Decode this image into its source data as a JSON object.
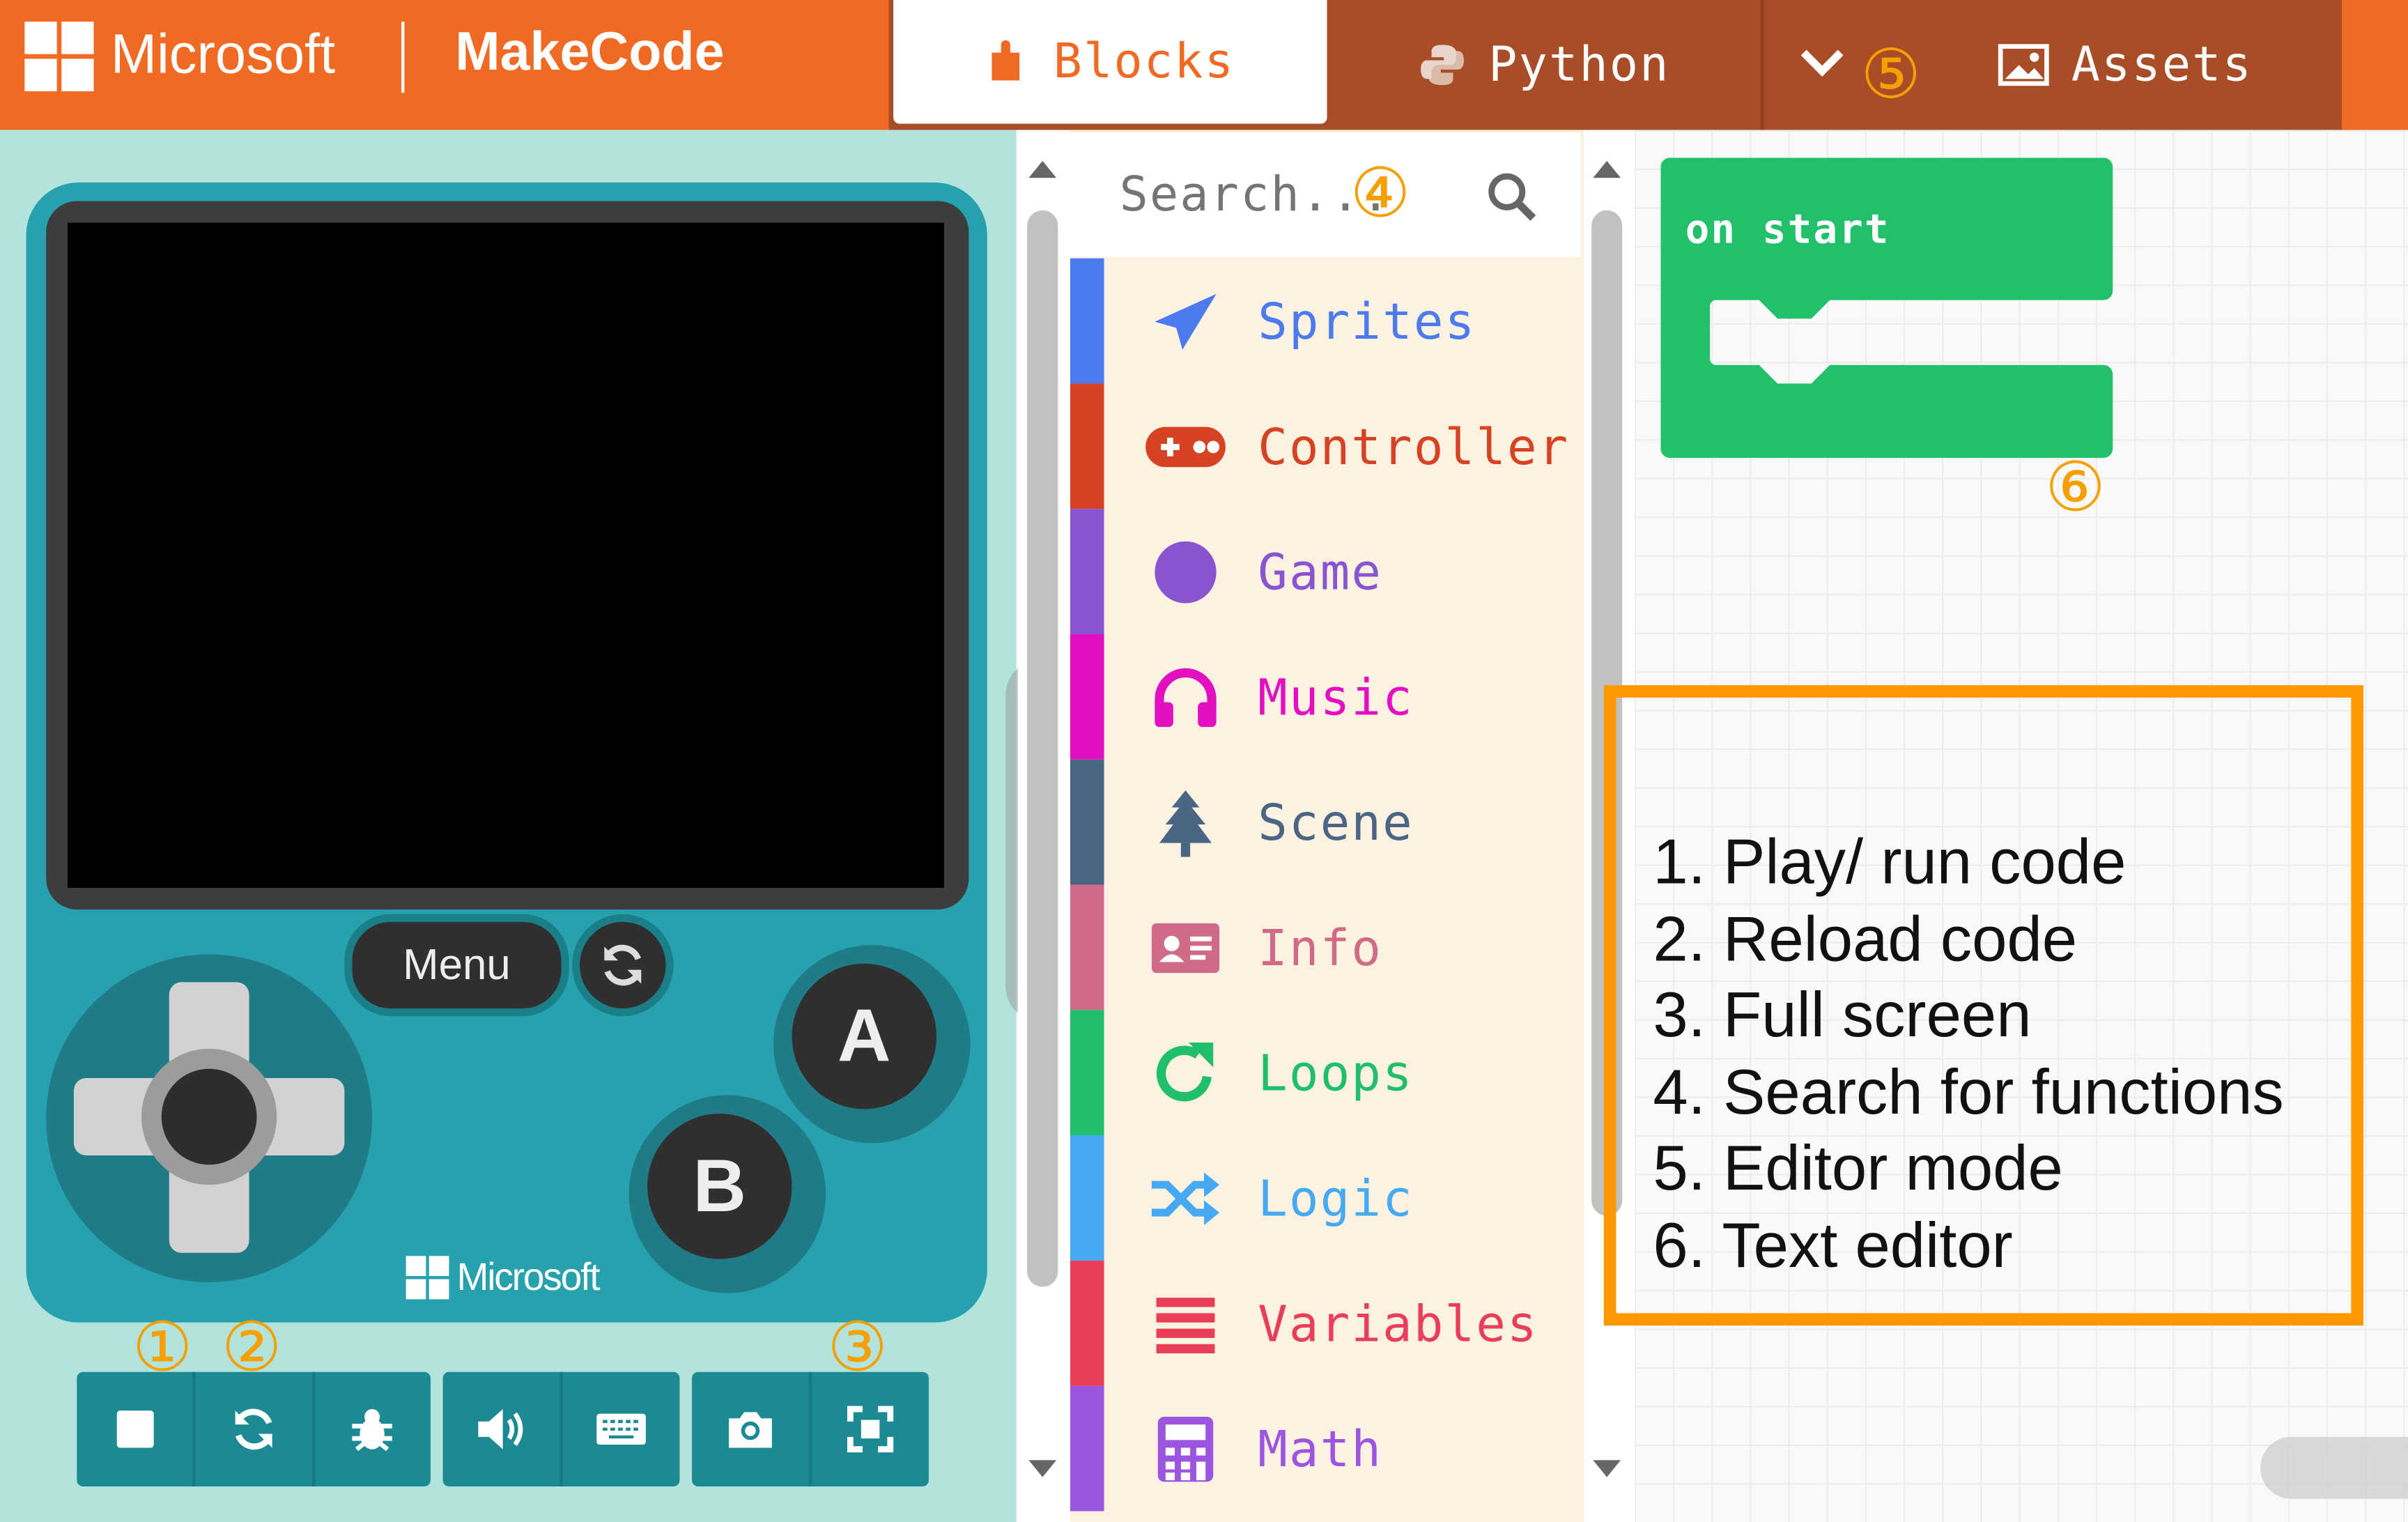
{
  "header": {
    "brand": "Microsoft",
    "product": "MakeCode",
    "tabs": [
      {
        "label": "Blocks",
        "active": true
      },
      {
        "label": "Python",
        "active": false
      },
      {
        "label": "Assets",
        "active": false
      }
    ]
  },
  "simulator": {
    "menu_label": "Menu",
    "button_a": "A",
    "button_b": "B",
    "device_brand": "Microsoft",
    "toolbar": [
      "stop",
      "restart",
      "debug",
      "sound",
      "keyboard",
      "screenshot",
      "fullscreen"
    ]
  },
  "toolbox": {
    "search_placeholder": "Search...",
    "categories": [
      {
        "label": "Sprites",
        "color": "#4b7bec",
        "icon": "paper-plane-icon"
      },
      {
        "label": "Controller",
        "color": "#d54322",
        "icon": "gamepad-icon"
      },
      {
        "label": "Game",
        "color": "#8854d0",
        "icon": "circle-icon"
      },
      {
        "label": "Music",
        "color": "#e30fc0",
        "icon": "headphones-icon"
      },
      {
        "label": "Scene",
        "color": "#4b6584",
        "icon": "tree-icon"
      },
      {
        "label": "Info",
        "color": "#cf6a87",
        "icon": "id-card-icon"
      },
      {
        "label": "Loops",
        "color": "#20bf6b",
        "icon": "redo-icon"
      },
      {
        "label": "Logic",
        "color": "#45aaf2",
        "icon": "shuffle-icon"
      },
      {
        "label": "Variables",
        "color": "#e83e58",
        "icon": "list-icon"
      },
      {
        "label": "Math",
        "color": "#9c55e0",
        "icon": "calculator-icon"
      }
    ]
  },
  "workspace": {
    "block_label": "on start",
    "block_color": "#23c06c"
  },
  "annotations": {
    "markers": [
      "①",
      "②",
      "③",
      "④",
      "⑤",
      "⑥"
    ],
    "legend": [
      "1. Play/ run code",
      "2. Reload code",
      "3. Full screen",
      "4. Search for functions",
      "5. Editor mode",
      "6. Text editor"
    ],
    "accent": "#ff9800"
  }
}
